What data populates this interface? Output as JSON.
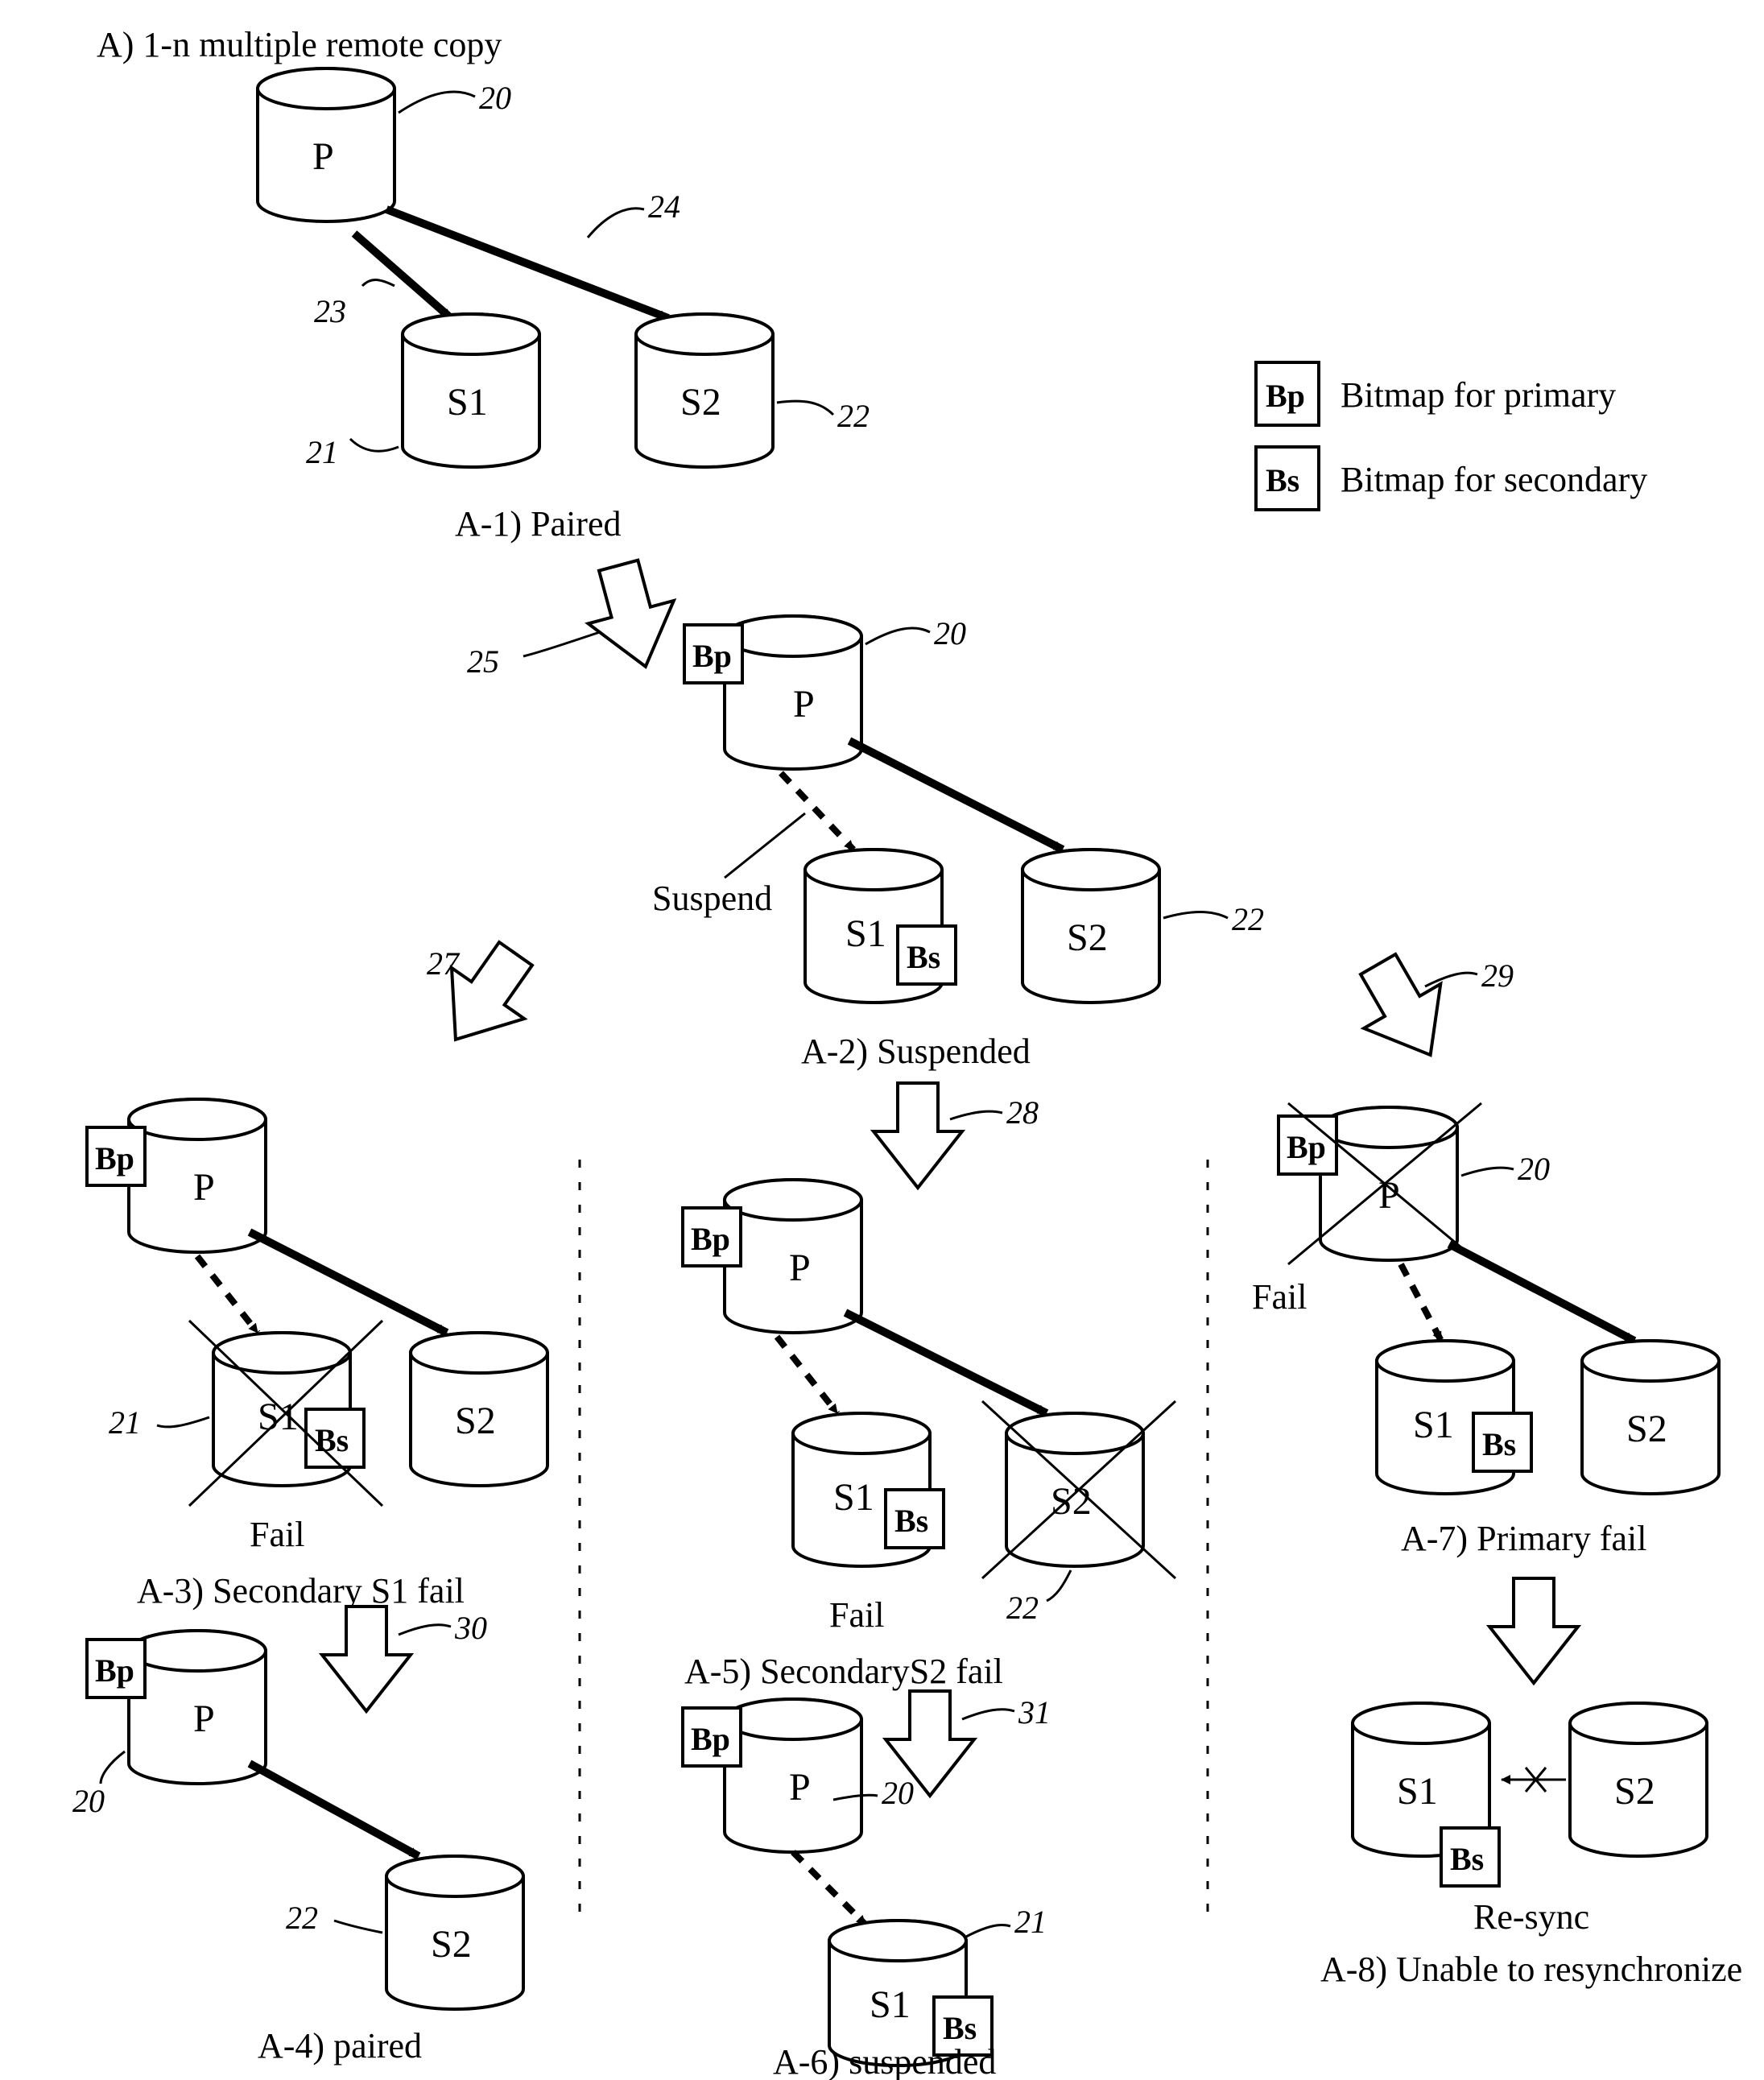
{
  "title": "A) 1-n multiple remote copy",
  "legend": {
    "bp_box": "Bp",
    "bp_text": "Bitmap for primary",
    "bs_box": "Bs",
    "bs_text": "Bitmap for secondary"
  },
  "labels": {
    "P": "P",
    "S1": "S1",
    "S2": "S2",
    "Bp": "Bp",
    "Bs": "Bs",
    "Suspend": "Suspend",
    "Fail": "Fail",
    "Resync": "Re-sync"
  },
  "captions": {
    "a1": "A-1) Paired",
    "a2": "A-2) Suspended",
    "a3": "A-3) Secondary S1 fail",
    "a4": "A-4) paired",
    "a5": "A-5) SecondaryS2 fail",
    "a6": "A-6) suspended",
    "a7": "A-7) Primary fail",
    "a8": "A-8) Unable to resynchronize"
  },
  "refs": {
    "r20": "20",
    "r21": "21",
    "r22": "22",
    "r23": "23",
    "r24": "24",
    "r25": "25",
    "r27": "27",
    "r28": "28",
    "r29": "29",
    "r30": "30",
    "r31": "31"
  }
}
